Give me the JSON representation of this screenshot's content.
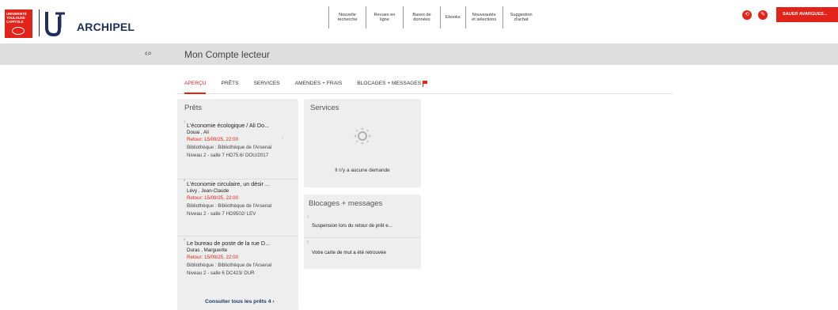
{
  "header": {
    "logo_ut1_lines": [
      "UNIVERSITÉ",
      "TOULOUSE",
      "CAPITOLE"
    ],
    "logo_u": "U",
    "brand": "ARCHIPEL",
    "nav": [
      {
        "label": "Nouvelle recherche"
      },
      {
        "label": "Revues en ligne"
      },
      {
        "label": "Bases de données"
      },
      {
        "label": "Ebooks"
      },
      {
        "label": "Nouveautés et sélections"
      },
      {
        "label": "Suggestion d'achat"
      }
    ],
    "icons": [
      "history-icon",
      "pin-icon"
    ],
    "user_button": "SAUER AVARGUES..."
  },
  "bar": {
    "back_icon": "‹⌕",
    "title": "Mon Compte lecteur"
  },
  "tabs": [
    {
      "label": "APERÇU",
      "active": true
    },
    {
      "label": "PRÊTS",
      "active": false
    },
    {
      "label": "SERVICES",
      "active": false
    },
    {
      "label": "AMENDES + FRAIS",
      "active": false
    },
    {
      "label": "BLOCAGES + MESSAGES",
      "active": false
    }
  ],
  "prets": {
    "title": "Prêts",
    "loans": [
      {
        "index": "1",
        "title": "L'économie écologique / Ali Do...",
        "author": "Douai , Ali",
        "return": "Retour: 15/09/25, 22:00",
        "library": "Bibliothèque : Bibliothèque de l'Arsenal Niveau 2 - salle 7 HD75.6/ DOU/2017"
      },
      {
        "index": "2",
        "title": "L'économie circulaire, un désir ...",
        "author": "Lévy , Jean-Claude",
        "return": "Retour: 15/09/25, 22:00",
        "library": "Bibliothèque : Bibliothèque de l'Arsenal Niveau 2 - salle 7 HD9502/ LEV"
      },
      {
        "index": "3",
        "title": "Le bureau de poste de la rue D...",
        "author": "Duras , Marguerite",
        "return": "Retour: 15/09/25, 22:00",
        "library": "Bibliothèque : Bibliothèque de l'Arsenal Niveau 2 - salle 6 DC423/ DUR"
      }
    ],
    "see_all": "Consulter tous les prêts 4  ›"
  },
  "services": {
    "title": "Services",
    "empty_text": "Il n'y a aucune demande"
  },
  "blocages": {
    "title": "Blocages + messages",
    "messages": [
      {
        "index": "1",
        "text": "Suspension lors du retour de prêt e..."
      },
      {
        "index": "2",
        "text": "Votre carte de mut a été retrouvée"
      }
    ]
  },
  "colors": {
    "accent": "#e2231a",
    "navy": "#1f2e5c",
    "card_bg": "#eeeeee",
    "bar_bg": "#dedede"
  }
}
